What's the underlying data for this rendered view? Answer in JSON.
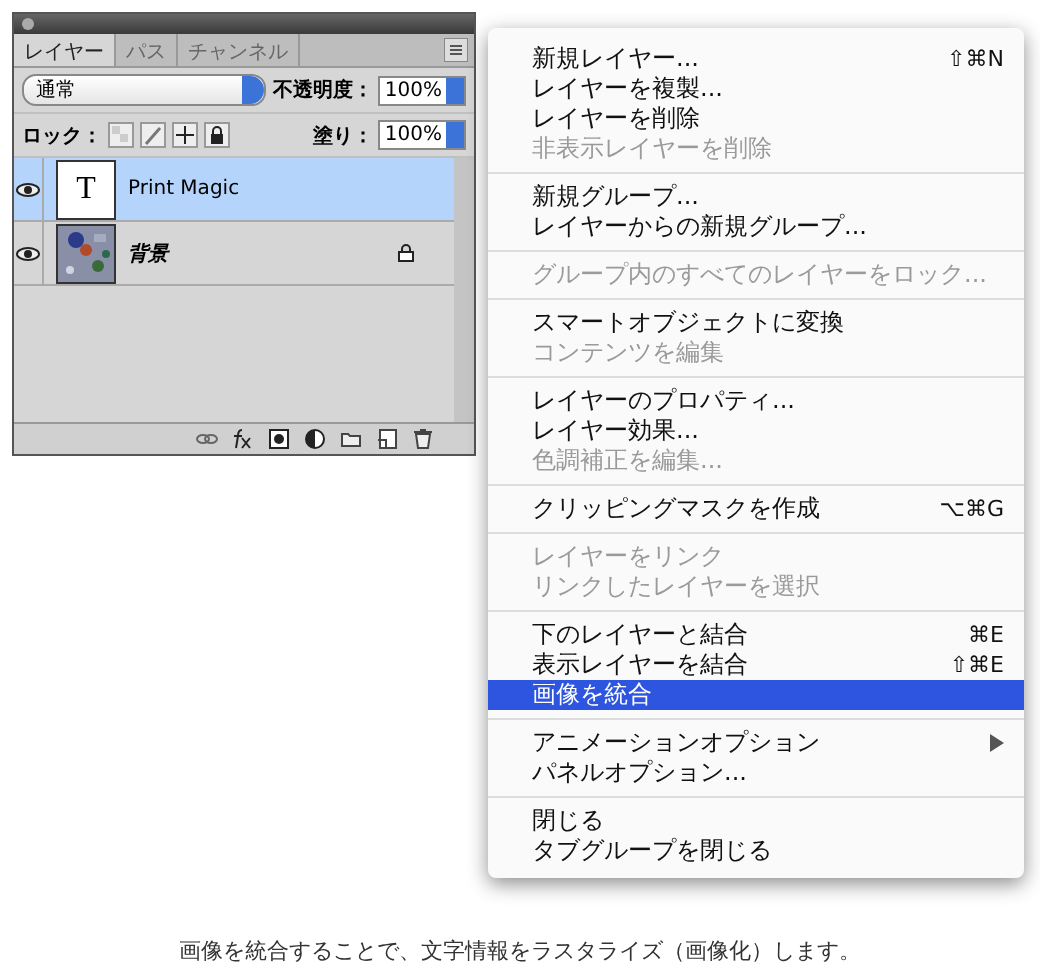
{
  "panel": {
    "tabs": [
      {
        "label": "レイヤー",
        "selected": true
      },
      {
        "label": "パス",
        "selected": false
      },
      {
        "label": "チャンネル",
        "selected": false
      }
    ],
    "blend_mode": "通常",
    "opacity_label": "不透明度：",
    "opacity": "100%",
    "lock_label": "ロック：",
    "fill_label": "塗り：",
    "fill": "100%",
    "layers": [
      {
        "name": "Print Magic",
        "kind": "text",
        "thumb_text": "T",
        "selected": true,
        "visible": true,
        "locked": false
      },
      {
        "name": "背景",
        "kind": "background",
        "selected": false,
        "visible": true,
        "locked": true
      }
    ]
  },
  "menu": {
    "groups": [
      [
        {
          "label": "新規レイヤー...",
          "shortcut": "⇧⌘N",
          "disabled": false,
          "selected": false
        },
        {
          "label": "レイヤーを複製...",
          "disabled": false,
          "selected": false
        },
        {
          "label": "レイヤーを削除",
          "disabled": false,
          "selected": false
        },
        {
          "label": "非表示レイヤーを削除",
          "disabled": true,
          "selected": false
        }
      ],
      [
        {
          "label": "新規グループ...",
          "disabled": false,
          "selected": false
        },
        {
          "label": "レイヤーからの新規グループ...",
          "disabled": false,
          "selected": false
        }
      ],
      [
        {
          "label": "グループ内のすべてのレイヤーをロック...",
          "disabled": true,
          "selected": false
        }
      ],
      [
        {
          "label": "スマートオブジェクトに変換",
          "disabled": false,
          "selected": false
        },
        {
          "label": "コンテンツを編集",
          "disabled": true,
          "selected": false
        }
      ],
      [
        {
          "label": "レイヤーのプロパティ...",
          "disabled": false,
          "selected": false
        },
        {
          "label": "レイヤー効果...",
          "disabled": false,
          "selected": false
        },
        {
          "label": "色調補正を編集...",
          "disabled": true,
          "selected": false
        }
      ],
      [
        {
          "label": "クリッピングマスクを作成",
          "shortcut": "⌥⌘G",
          "disabled": false,
          "selected": false
        }
      ],
      [
        {
          "label": "レイヤーをリンク",
          "disabled": true,
          "selected": false
        },
        {
          "label": "リンクしたレイヤーを選択",
          "disabled": true,
          "selected": false
        }
      ],
      [
        {
          "label": "下のレイヤーと結合",
          "shortcut": "⌘E",
          "disabled": false,
          "selected": false
        },
        {
          "label": "表示レイヤーを結合",
          "shortcut": "⇧⌘E",
          "disabled": false,
          "selected": false
        },
        {
          "label": "画像を統合",
          "disabled": false,
          "selected": true
        }
      ],
      [
        {
          "label": "アニメーションオプション",
          "submenu": true,
          "disabled": false,
          "selected": false
        },
        {
          "label": "パネルオプション...",
          "disabled": false,
          "selected": false
        }
      ],
      [
        {
          "label": "閉じる",
          "disabled": false,
          "selected": false
        },
        {
          "label": "タブグループを閉じる",
          "disabled": false,
          "selected": false
        }
      ]
    ]
  },
  "caption": "画像を統合することで、文字情報をラスタライズ（画像化）します。"
}
